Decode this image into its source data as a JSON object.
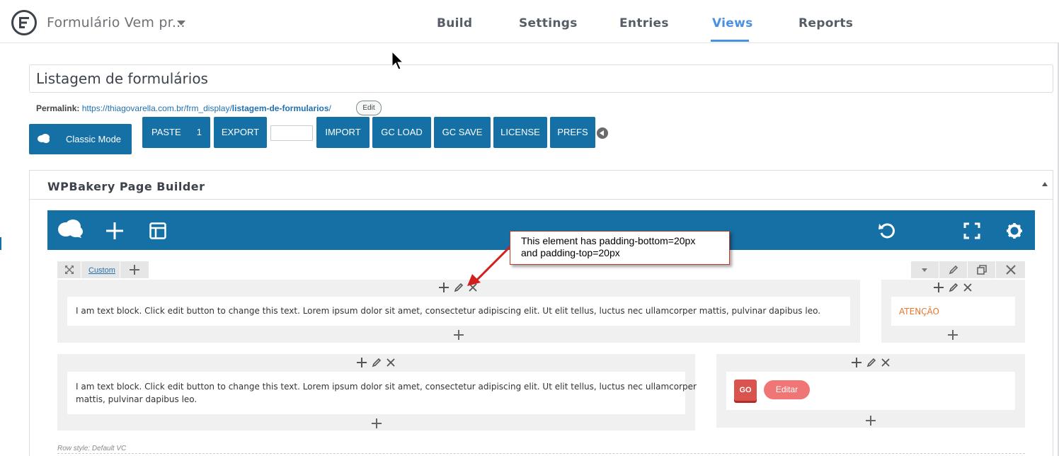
{
  "topbar": {
    "form_title": "Formulário Vem pr...",
    "tabs": [
      "Build",
      "Settings",
      "Entries",
      "Views",
      "Reports"
    ],
    "active_tab": "Views",
    "accent_color": "#4a90e2"
  },
  "view": {
    "title": "Listagem de formulários",
    "permalink_label": "Permalink:",
    "permalink_base": "https://thiagovarella.com.br/frm_display/",
    "permalink_slug": "listagem-de-formularios",
    "permalink_trailing": "/",
    "edit_label": "Edit"
  },
  "toolbar": {
    "classic_mode": "Classic Mode",
    "paste": "PASTE",
    "paste_count": "1",
    "export": "EXPORT",
    "import": "IMPORT",
    "gc_load": "GC LOAD",
    "gc_save": "GC SAVE",
    "license": "LICENSE",
    "prefs": "PREFS",
    "button_color": "#1570a6"
  },
  "builder": {
    "title": "WPBakery Page Builder",
    "custom_link": "Custom",
    "row_style": "Row style: Default VC",
    "text_block_1": "I am text block. Click edit button to change this text. Lorem ipsum dolor sit amet, consectetur adipiscing elit. Ut elit tellus, luctus nec ullamcorper mattis, pulvinar dapibus leo.",
    "text_block_2_line1": "I am text block. Click edit button to change this text. Lorem ipsum dolor sit amet, consectetur adipiscing elit. Ut elit tellus, luctus nec ullamcorper",
    "text_block_2_line2": "mattis, pulvinar dapibus leo.",
    "atencao": "ATENÇÃO",
    "go_label": "GO",
    "editar_label": "Editar"
  },
  "annotation": {
    "line1": "This element has padding-bottom=20px",
    "line2": "and padding-top=20px"
  }
}
